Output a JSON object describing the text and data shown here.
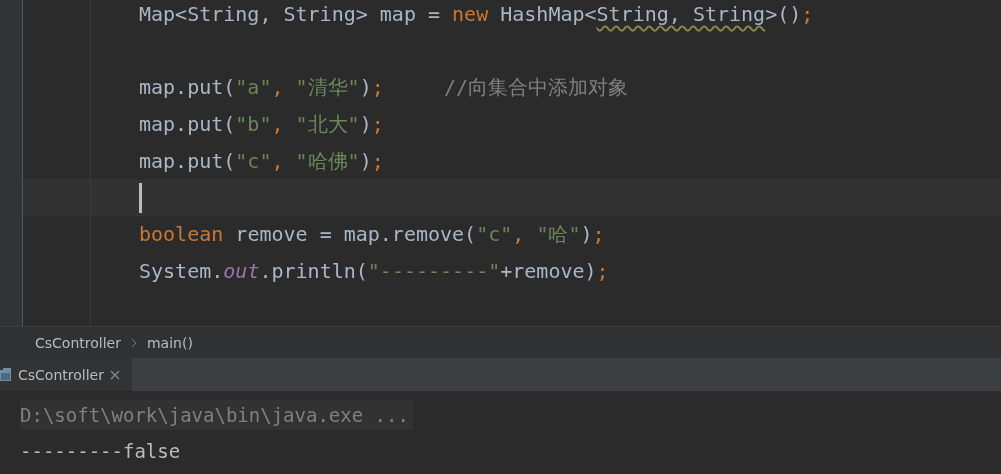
{
  "editor": {
    "lines": [
      {
        "kind": "code",
        "tokens": [
          {
            "kind": "plain",
            "text": "Map<String, String> map = "
          },
          {
            "kind": "keyword",
            "text": "new"
          },
          {
            "kind": "plain",
            "text": " HashMap<"
          },
          {
            "kind": "warning",
            "text": "String, String"
          },
          {
            "kind": "plain",
            "text": ">()"
          },
          {
            "kind": "keyword",
            "text": ";"
          }
        ]
      },
      {
        "kind": "blank"
      },
      {
        "kind": "code",
        "tokens": [
          {
            "kind": "plain",
            "text": "map.put("
          },
          {
            "kind": "string",
            "text": "\"a\""
          },
          {
            "kind": "keyword",
            "text": ", "
          },
          {
            "kind": "string",
            "text": "\"清华\""
          },
          {
            "kind": "plain",
            "text": ")"
          },
          {
            "kind": "keyword",
            "text": ";"
          },
          {
            "kind": "comment",
            "text": "//向集合中添加对象"
          }
        ]
      },
      {
        "kind": "code",
        "tokens": [
          {
            "kind": "plain",
            "text": "map.put("
          },
          {
            "kind": "string",
            "text": "\"b\""
          },
          {
            "kind": "keyword",
            "text": ", "
          },
          {
            "kind": "string",
            "text": "\"北大\""
          },
          {
            "kind": "plain",
            "text": ")"
          },
          {
            "kind": "keyword",
            "text": ";"
          }
        ]
      },
      {
        "kind": "code",
        "tokens": [
          {
            "kind": "plain",
            "text": "map.put("
          },
          {
            "kind": "string",
            "text": "\"c\""
          },
          {
            "kind": "keyword",
            "text": ", "
          },
          {
            "kind": "string",
            "text": "\"哈佛\""
          },
          {
            "kind": "plain",
            "text": ")"
          },
          {
            "kind": "keyword",
            "text": ";"
          }
        ]
      },
      {
        "kind": "cursor"
      },
      {
        "kind": "code",
        "tokens": [
          {
            "kind": "keyword",
            "text": "boolean"
          },
          {
            "kind": "plain",
            "text": " remove = map.remove("
          },
          {
            "kind": "string",
            "text": "\"c\""
          },
          {
            "kind": "keyword",
            "text": ", "
          },
          {
            "kind": "string",
            "text": "\"哈\""
          },
          {
            "kind": "plain",
            "text": ")"
          },
          {
            "kind": "keyword",
            "text": ";"
          }
        ]
      },
      {
        "kind": "code",
        "tokens": [
          {
            "kind": "plain",
            "text": "System."
          },
          {
            "kind": "field",
            "text": "out"
          },
          {
            "kind": "plain",
            "text": ".println("
          },
          {
            "kind": "string",
            "text": "\"---------\""
          },
          {
            "kind": "plain",
            "text": "+remove)"
          },
          {
            "kind": "keyword",
            "text": ";"
          }
        ]
      },
      {
        "kind": "blank"
      }
    ]
  },
  "breadcrumbs": [
    "CsController",
    "main()"
  ],
  "run_tabs": [
    {
      "label": "CsController",
      "selected": true
    }
  ],
  "console": {
    "lines": [
      {
        "kind": "command",
        "text": "D:\\soft\\work\\java\\bin\\java.exe ..."
      },
      {
        "kind": "output",
        "text": "---------false"
      }
    ]
  }
}
